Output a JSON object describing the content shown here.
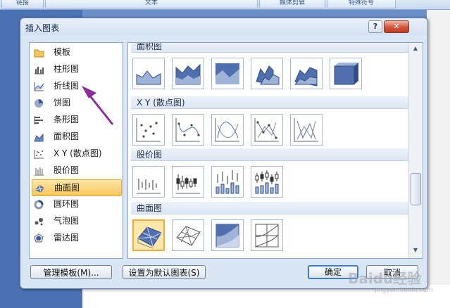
{
  "background": {
    "ribbon_tabs": [
      "链接",
      "文本",
      "媒体剪辑",
      "特殊符号"
    ]
  },
  "dialog": {
    "title": "插入图表",
    "help_button": "?",
    "close_button": "✕"
  },
  "chart_types": [
    {
      "label": "模板",
      "icon": "folder-icon"
    },
    {
      "label": "柱形图",
      "icon": "column-chart-icon"
    },
    {
      "label": "折线图",
      "icon": "line-chart-icon"
    },
    {
      "label": "饼图",
      "icon": "pie-chart-icon"
    },
    {
      "label": "条形图",
      "icon": "bar-chart-icon"
    },
    {
      "label": "面积图",
      "icon": "area-chart-icon"
    },
    {
      "label": "X Y (散点图)",
      "icon": "scatter-chart-icon"
    },
    {
      "label": "股价图",
      "icon": "stock-chart-icon"
    },
    {
      "label": "曲面图",
      "icon": "surface-chart-icon",
      "selected": true
    },
    {
      "label": "圆环图",
      "icon": "doughnut-chart-icon"
    },
    {
      "label": "气泡图",
      "icon": "bubble-chart-icon"
    },
    {
      "label": "雷达图",
      "icon": "radar-chart-icon"
    }
  ],
  "gallery": {
    "sections": [
      {
        "title": "面积图",
        "thumbs": [
          "area",
          "stacked-area",
          "100-area",
          "3d-area",
          "3d-stacked-area",
          "3d-100-area"
        ]
      },
      {
        "title": "X Y (散点图)",
        "thumbs": [
          "scatter-markers",
          "scatter-smooth-markers",
          "scatter-smooth",
          "scatter-lines-markers",
          "scatter-lines"
        ]
      },
      {
        "title": "股价图",
        "thumbs": [
          "stock-hlc",
          "stock-ohlc",
          "stock-vhlc",
          "stock-vohlc"
        ]
      },
      {
        "title": "曲面图",
        "thumbs": [
          "3d-surface",
          "wireframe-3d-surface",
          "contour",
          "wireframe-contour"
        ],
        "selected_index": 0
      }
    ]
  },
  "buttons": {
    "manage_templates": "管理模板(M)...",
    "set_default": "设置为默认图表(S)",
    "ok": "确定",
    "cancel": "取消"
  },
  "watermark": {
    "text": "Baidu经验",
    "sub": "jingyan.baidu.com"
  },
  "colors": {
    "selection_fill": "#f8c65a",
    "annotation_arrow": "#8e2b9c",
    "chart_blue": "#4f6fae"
  }
}
